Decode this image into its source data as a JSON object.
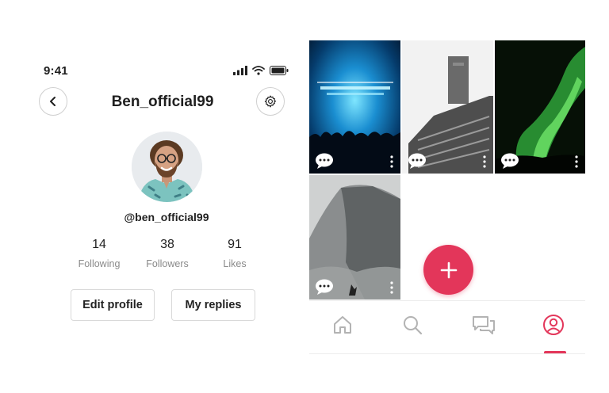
{
  "colors": {
    "accent": "#e3365a",
    "text": "#1f1f1f",
    "muted": "#8a8a8a",
    "border": "#d9d9d9"
  },
  "status_bar": {
    "time": "9:41",
    "icons": [
      "signal-icon",
      "wifi-icon",
      "battery-icon"
    ]
  },
  "header": {
    "title": "Ben_official99",
    "back_icon": "chevron-left-icon",
    "settings_icon": "gear-icon"
  },
  "profile": {
    "handle": "@ben_official99",
    "stats": [
      {
        "value": "14",
        "label": "Following"
      },
      {
        "value": "38",
        "label": "Followers"
      },
      {
        "value": "91",
        "label": "Likes"
      }
    ],
    "buttons": {
      "edit": "Edit profile",
      "replies": "My replies"
    }
  },
  "posts": [
    {
      "subject": "concert",
      "icons": [
        "chat-bubble-icon",
        "more-vertical-icon"
      ]
    },
    {
      "subject": "building",
      "icons": [
        "chat-bubble-icon",
        "more-vertical-icon"
      ]
    },
    {
      "subject": "aurora",
      "icons": [
        "chat-bubble-icon",
        "more-vertical-icon"
      ]
    },
    {
      "subject": "mountain",
      "icons": [
        "chat-bubble-icon",
        "more-vertical-icon"
      ]
    }
  ],
  "fab": {
    "icon": "plus-icon"
  },
  "tabs": [
    {
      "icon": "home-icon",
      "active": false
    },
    {
      "icon": "search-icon",
      "active": false
    },
    {
      "icon": "messages-icon",
      "active": false
    },
    {
      "icon": "profile-icon",
      "active": true
    }
  ]
}
